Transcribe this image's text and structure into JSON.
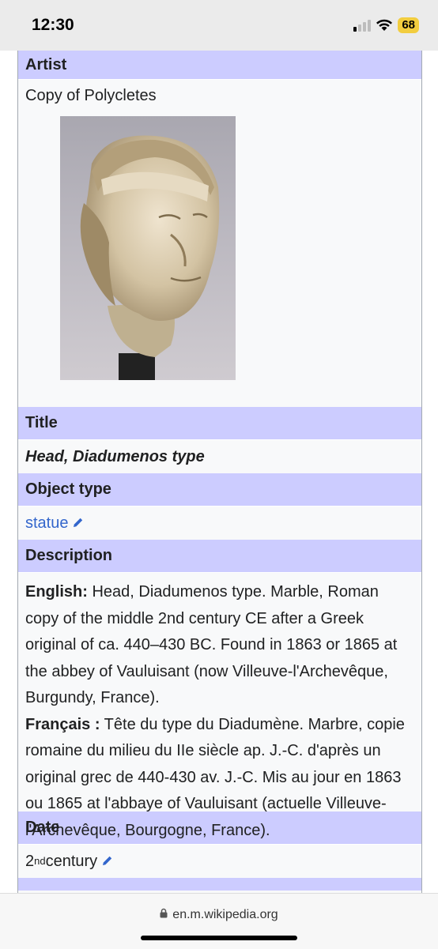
{
  "status": {
    "time": "12:30",
    "battery": "68"
  },
  "infobox": {
    "artist_label": "Artist",
    "artist_value": "Copy of Polycletes",
    "title_label": "Title",
    "title_value": "Head, Diadumenos type",
    "object_type_label": "Object type",
    "object_type_value": "statue",
    "description_label": "Description",
    "description": {
      "en_label": "English:",
      "en_text": " Head, Diadumenos type. Marble, Roman copy of the middle 2nd century CE after a Greek original of ca. 440–430 BC. Found in 1863 or 1865 at the abbey of Vauluisant (now Villeuve-l'Archevêque, Burgundy, France).",
      "fr_label": "Français :",
      "fr_text": " Tête du type du Diadumène. Marbre, copie romaine du milieu du IIe siècle ap. J.-C. d'après un original grec de 440-430 av. J.-C. Mis au jour en 1863 ou 1865 at l'abbaye of Vauluisant (actuelle Villeuve-l'Archevêque, Bourgogne, France)."
    },
    "date_label": "Date",
    "date_number": "2",
    "date_suffix": "nd",
    "date_word": " century"
  },
  "browser": {
    "url": "en.m.wikipedia.org"
  },
  "colors": {
    "header_bg": "#ccccff",
    "link": "#3366cc",
    "cell_bg": "#f8f9fa"
  },
  "icons": [
    "signal-icon",
    "wifi-icon",
    "pencil-icon",
    "lock-icon"
  ]
}
